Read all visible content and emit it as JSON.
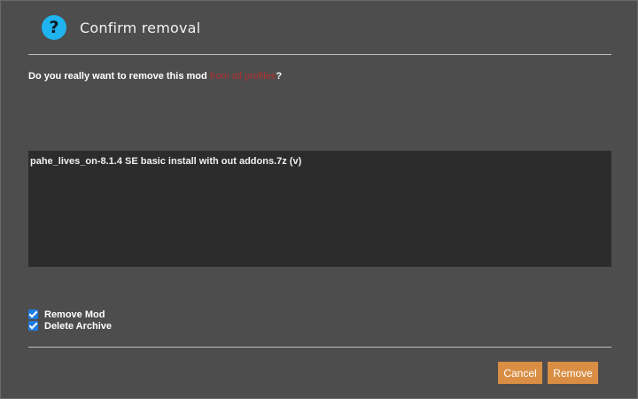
{
  "dialog": {
    "title": "Confirm removal",
    "icon": "question-icon",
    "icon_glyph": "?",
    "accent_color": "#1fb4f0"
  },
  "question": {
    "prefix": "Do you really want to remove this mod",
    "highlight": "from all profiles",
    "suffix": "?"
  },
  "mods": [
    "pahe_lives_on-8.1.4 SE basic install with out addons.7z (v)"
  ],
  "options": [
    {
      "label": "Remove Mod",
      "checked": true
    },
    {
      "label": "Delete Archive",
      "checked": true
    }
  ],
  "buttons": {
    "cancel_label": "Cancel",
    "remove_label": "Remove",
    "button_color": "#d98e43"
  }
}
